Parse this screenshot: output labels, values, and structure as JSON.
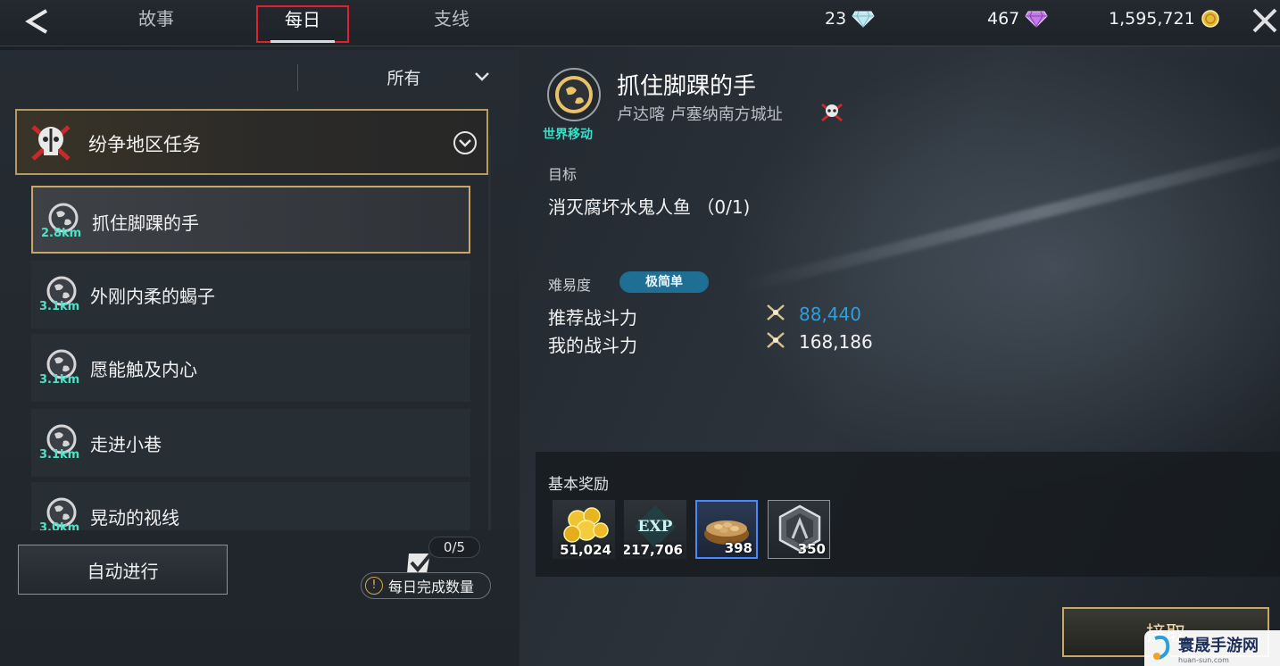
{
  "header": {
    "tabs": [
      {
        "label": "故事",
        "active": false
      },
      {
        "label": "每日",
        "active": true
      },
      {
        "label": "支线",
        "active": false
      }
    ],
    "currencies": [
      {
        "value": "23",
        "icon": "diamond-icon"
      },
      {
        "value": "467",
        "icon": "purple-gem-icon"
      },
      {
        "value": "1,595,721",
        "icon": "gold-coin-icon"
      }
    ]
  },
  "filter": {
    "selected": "所有"
  },
  "category": {
    "title": "纷争地区任务"
  },
  "quests": [
    {
      "name": "抓住脚踝的手",
      "distance": "2.8km",
      "active": true
    },
    {
      "name": "外刚内柔的蝎子",
      "distance": "3.1km",
      "active": false
    },
    {
      "name": "愿能触及内心",
      "distance": "3.1km",
      "active": false
    },
    {
      "name": "走进小巷",
      "distance": "3.1km",
      "active": false
    },
    {
      "name": "晃动的视线",
      "distance": "3.0km",
      "active": false
    }
  ],
  "footer": {
    "auto_label": "自动进行",
    "daily_count": "0/5",
    "daily_label": "每日完成数量"
  },
  "detail": {
    "world_move_label": "世界移动",
    "title": "抓住脚踝的手",
    "location": "卢达喀 卢塞纳南方城址",
    "objective_label": "目标",
    "objective": "消灭腐坏水鬼人鱼 （0/1)",
    "difficulty_label": "难易度",
    "difficulty": "极简单",
    "recommended_label": "推荐战斗力",
    "recommended_value": "88,440",
    "my_label": "我的战斗力",
    "my_value": "168,186",
    "rewards_label": "基本奖励",
    "rewards": [
      {
        "name": "gold-coins",
        "qty": "51,024"
      },
      {
        "name": "exp",
        "label": "EXP",
        "qty": "217,706"
      },
      {
        "name": "nuts-bowl",
        "qty": "398"
      },
      {
        "name": "hex-emblem",
        "qty": "350"
      }
    ],
    "accept_label": "接取"
  },
  "watermark": {
    "text": "寰晟手游网",
    "sub": "huan-sun.com"
  },
  "colors": {
    "accent_gold": "#c9a867",
    "tab_highlight": "#e0202a",
    "teal": "#38e0c8",
    "blue_value": "#2e9fd8",
    "badge_blue": "#1f6e94"
  }
}
